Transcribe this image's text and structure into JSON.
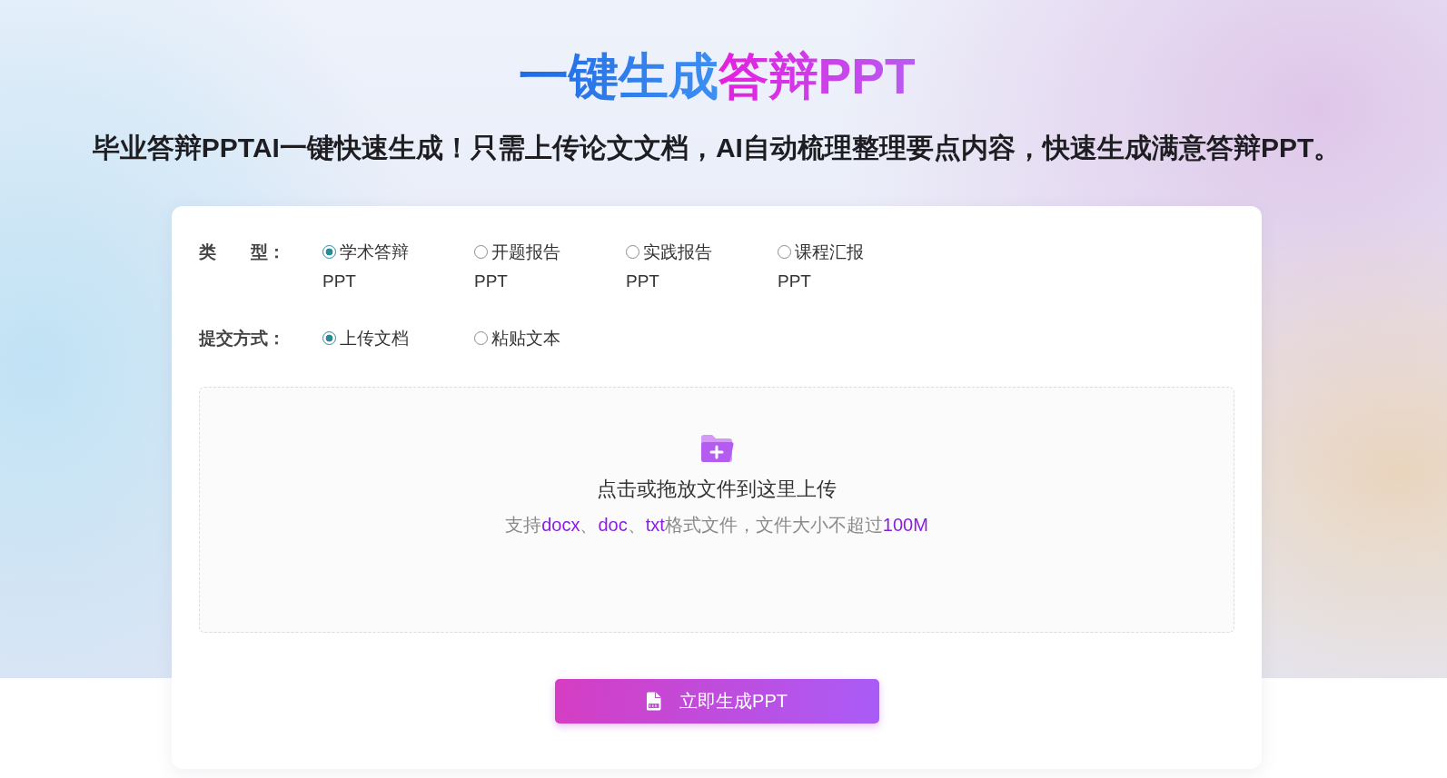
{
  "hero": {
    "title": [
      {
        "text": "一键生成",
        "kind": "plain"
      },
      {
        "text": "答辩PPT",
        "kind": "highlight"
      }
    ],
    "subtitle": "毕业答辩PPTAI一键快速生成！只需上传论文文档，AI自动梳理整理要点内容，快速生成满意答辩PPT。"
  },
  "form": {
    "type_field": {
      "label": "类　　型：",
      "options": [
        {
          "label": "学术答辩PPT",
          "selected": true
        },
        {
          "label": "开题报告PPT",
          "selected": false
        },
        {
          "label": "实践报告PPT",
          "selected": false
        },
        {
          "label": "课程汇报PPT",
          "selected": false
        }
      ]
    },
    "submit_field": {
      "label": "提交方式：",
      "options": [
        {
          "label": "上传文档",
          "selected": true
        },
        {
          "label": "粘贴文本",
          "selected": false
        }
      ]
    },
    "upload": {
      "prompt": "点击或拖放文件到这里上传",
      "hint": [
        {
          "text": "支持",
          "kind": "plain"
        },
        {
          "text": "docx",
          "kind": "highlight"
        },
        {
          "text": "、",
          "kind": "plain"
        },
        {
          "text": "doc",
          "kind": "highlight"
        },
        {
          "text": "、",
          "kind": "plain"
        },
        {
          "text": "txt",
          "kind": "highlight"
        },
        {
          "text": "格式文件，文件大小不超过",
          "kind": "plain"
        },
        {
          "text": "100M",
          "kind": "highlight"
        }
      ]
    },
    "button": {
      "label": "立即生成PPT"
    }
  }
}
